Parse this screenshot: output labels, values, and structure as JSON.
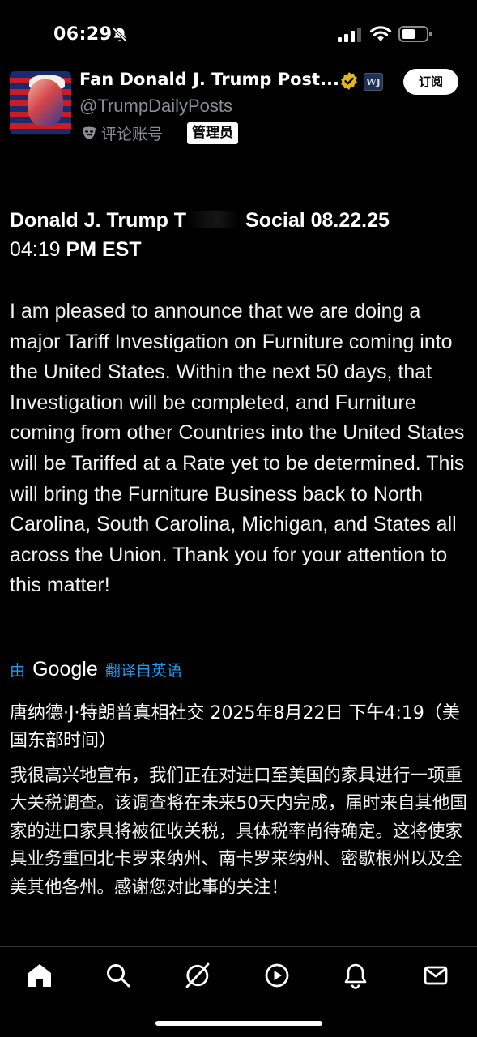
{
  "status_bar": {
    "time": "06:29",
    "icons": [
      "bell-slash-icon",
      "signal-icon",
      "wifi-icon",
      "battery-icon"
    ]
  },
  "profile": {
    "display_name": "Fan Donald J. Trump Post...",
    "affiliate_badge": "WJ",
    "handle": "@TrumpDailyPosts",
    "commentary_label": "评论账号",
    "admin_badge": "管理员",
    "subscribe_label": "订阅"
  },
  "post": {
    "title_before_redaction": "Donald J. Trump T",
    "title_after_redaction": "Social 08.22.25",
    "time_main": "04:19",
    "time_suffix": "PM EST",
    "body": "I am pleased to announce that we are doing a major Tariff Investigation on Furniture coming into the United States. Within the next 50 days, that Investigation will be completed, and Furniture coming from other Countries into the United States will be Tariffed at a Rate yet to be determined. This will bring the Furniture Business back to North Carolina, South Carolina, Michigan, and States all across the Union. Thank you for your attention to this matter!"
  },
  "translation": {
    "by_label": "由",
    "provider": "Google",
    "from_label": "翻译自英语",
    "title": "唐纳德·J·特朗普真相社交 2025年8月22日 下午4:19（美国东部时间）",
    "body": "我很高兴地宣布，我们正在对进口至美国的家具进行一项重大关税调查。该调查将在未来50天内完成，届时来自其他国家的进口家具将被征收关税，具体税率尚待确定。这将使家具业务重回北卡罗来纳州、南卡罗来纳州、密歇根州以及全美其他各州。感谢您对此事的关注！"
  },
  "bottom_nav": {
    "items": [
      "home-icon",
      "search-icon",
      "grok-icon",
      "video-icon",
      "notifications-icon",
      "messages-icon"
    ]
  },
  "colors": {
    "background": "#000000",
    "link_blue": "#1d9bf0",
    "muted_gray": "#8b8f94",
    "verified_gold": "#e2b719"
  }
}
